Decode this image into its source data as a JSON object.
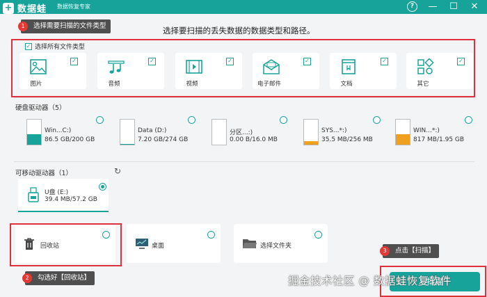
{
  "titlebar": {
    "app_name": "数据蛙",
    "app_sub": "数据恢复专家",
    "logo_mark": "+",
    "icons": {
      "help": "?",
      "minimize": "—",
      "maximize": "☐",
      "close": "✕"
    }
  },
  "headline": "选择要扫描的丢失数据的数据类型和路径。",
  "file_types": {
    "select_all_label": "选择所有文件类型",
    "items": [
      {
        "label": "图片",
        "icon": "image-icon",
        "checked": true
      },
      {
        "label": "音频",
        "icon": "audio-icon",
        "checked": true
      },
      {
        "label": "视频",
        "icon": "video-icon",
        "checked": true
      },
      {
        "label": "电子邮件",
        "icon": "email-icon",
        "checked": true
      },
      {
        "label": "文档",
        "icon": "document-icon",
        "checked": true
      },
      {
        "label": "其它",
        "icon": "other-icon",
        "checked": true
      }
    ]
  },
  "hdd": {
    "title": "硬盘驱动器（5）",
    "drives": [
      {
        "name": "Win...C:)",
        "size": "86.5 GB/200 GB",
        "fill": 0.43,
        "color": "#17a39a"
      },
      {
        "name": "Data (D:)",
        "size": "7.20 GB/274 GB",
        "fill": 0.03,
        "color": "#17a39a"
      },
      {
        "name": "分区...:)",
        "size": "0.00  B/16.0 MB",
        "fill": 0.0,
        "color": "#f0a020"
      },
      {
        "name": "SYS...*:)",
        "size": "35.5 MB/256 MB",
        "fill": 0.14,
        "color": "#f0a020"
      },
      {
        "name": "WIN...*:)",
        "size": "817 MB/1.95 GB",
        "fill": 0.42,
        "color": "#f0a020"
      }
    ]
  },
  "removable": {
    "title": "可移动驱动器（1）",
    "refresh_icon": "↻",
    "drive": {
      "name": "U盘 (E:)",
      "size": "39.4 MB/57.2 GB"
    }
  },
  "locations": [
    {
      "label": "回收站",
      "icon": "recycle-bin-icon",
      "glyph": "🗑"
    },
    {
      "label": "桌面",
      "icon": "desktop-icon",
      "glyph": "▭"
    },
    {
      "label": "选择文件夹",
      "icon": "folder-icon",
      "glyph": "📂"
    }
  ],
  "callouts": {
    "step1": {
      "num": "1",
      "text": "选择需要扫描的文件类型"
    },
    "step2": {
      "num": "2",
      "text": "勾选好【回收站】"
    },
    "step3": {
      "num": "3",
      "text": "点击【扫描】"
    }
  },
  "start_button": "扫描",
  "watermark": "掘金技术社区 @ 数据蛙恢复软件",
  "colors": {
    "accent": "#17a39a",
    "highlight": "#e0303a",
    "warning": "#f0a020"
  }
}
